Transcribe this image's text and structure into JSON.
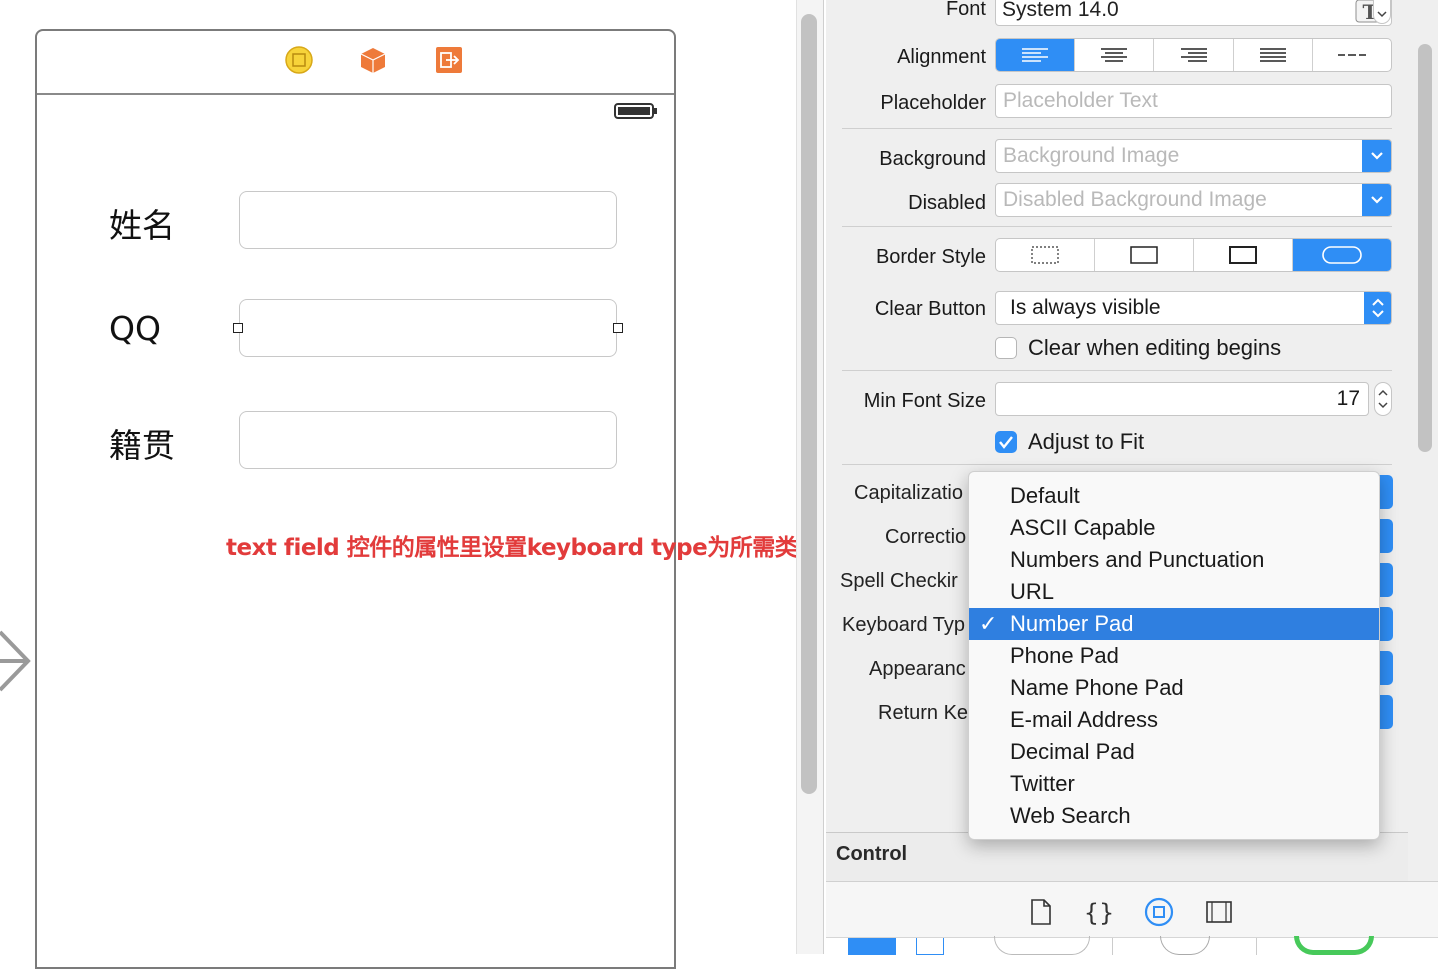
{
  "canvas": {
    "labels": [
      "姓名",
      "QQ",
      "籍贯"
    ],
    "annotation": "text field 控件的属性里设置keyboard type为所需类型"
  },
  "inspector": {
    "font": {
      "label": "Font",
      "value": "System 14.0"
    },
    "alignment": {
      "label": "Alignment",
      "selected_index": 0
    },
    "placeholder": {
      "label": "Placeholder",
      "placeholder": "Placeholder Text"
    },
    "background": {
      "label": "Background",
      "placeholder": "Background Image"
    },
    "disabled": {
      "label": "Disabled",
      "placeholder": "Disabled Background Image"
    },
    "border_style": {
      "label": "Border Style",
      "selected_index": 3
    },
    "clear_button": {
      "label": "Clear Button",
      "value": "Is always visible"
    },
    "clear_when_editing": {
      "label": "Clear when editing begins",
      "checked": false
    },
    "min_font_size": {
      "label": "Min Font Size",
      "value": "17"
    },
    "adjust_to_fit": {
      "label": "Adjust to Fit",
      "checked": true
    },
    "partial_labels": {
      "capitalization": "Capitalizatio",
      "correction": "Correctio",
      "spell_checking": "Spell Checkir",
      "keyboard_type": "Keyboard Typ",
      "appearance": "Appearanc",
      "return_key": "Return Ke"
    },
    "section_control": "Control"
  },
  "keyboard_menu": {
    "items": [
      "Default",
      "ASCII Capable",
      "Numbers and Punctuation",
      "URL",
      "Number Pad",
      "Phone Pad",
      "Name Phone Pad",
      "E-mail Address",
      "Decimal Pad",
      "Twitter",
      "Web Search"
    ],
    "selected": "Number Pad"
  },
  "colors": {
    "accent": "#2f8ef5",
    "annotation": "#e23b3b",
    "menu_highlight": "#2f7fe0"
  },
  "icons": [
    "view-controller-icon",
    "first-responder-icon",
    "exit-icon",
    "battery-icon",
    "file-inspector-icon",
    "code-braces-icon",
    "object-library-icon",
    "media-library-icon"
  ]
}
